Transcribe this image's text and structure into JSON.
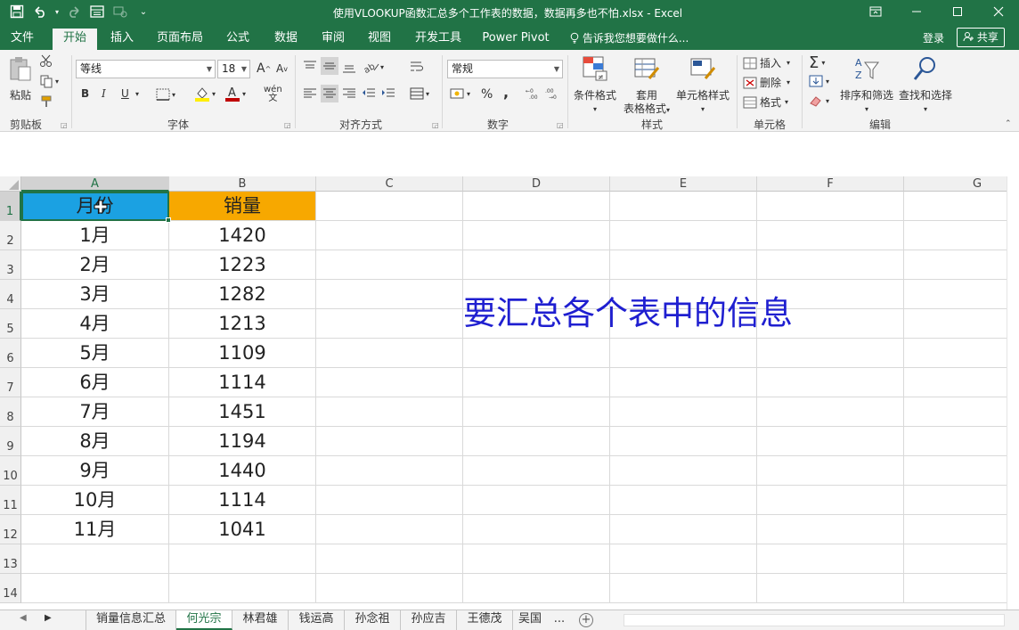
{
  "titlebar": {
    "doc_title": "使用VLOOKUP函数汇总多个工作表的数据，数据再多也不怕.xlsx - Excel",
    "qat_more": "⌄"
  },
  "tabs": [
    {
      "label": "文件"
    },
    {
      "label": "开始"
    },
    {
      "label": "插入"
    },
    {
      "label": "页面布局"
    },
    {
      "label": "公式"
    },
    {
      "label": "数据"
    },
    {
      "label": "审阅"
    },
    {
      "label": "视图"
    },
    {
      "label": "开发工具"
    },
    {
      "label": "Power Pivot"
    }
  ],
  "tellme": "告诉我您想要做什么...",
  "login": "登录",
  "share": "共享",
  "ribbon": {
    "clipboard": {
      "paste": "粘贴",
      "group": "剪贴板"
    },
    "font": {
      "name": "等线",
      "size": "18",
      "group": "字体",
      "bold": "B",
      "italic": "I",
      "underline": "U",
      "grow": "A",
      "shrink": "A",
      "wen": "wén"
    },
    "align": {
      "group": "对齐方式"
    },
    "number": {
      "format": "常规",
      "group": "数字",
      "percent": "%",
      "comma": ","
    },
    "styles": {
      "cond": "条件格式",
      "table1": "套用",
      "table2": "表格格式",
      "cell": "单元格样式",
      "group": "样式"
    },
    "cells": {
      "insert": "插入",
      "delete": "删除",
      "format": "格式",
      "group": "单元格"
    },
    "editing": {
      "sort": "排序和筛选",
      "find": "查找和选择",
      "group": "编辑"
    }
  },
  "columns": [
    "A",
    "B",
    "C",
    "D",
    "E",
    "F",
    "G"
  ],
  "rows": [
    "1",
    "2",
    "3",
    "4",
    "5",
    "6",
    "7",
    "8",
    "9",
    "10",
    "11",
    "12",
    "13",
    "14"
  ],
  "table": {
    "header": [
      "月份",
      "销量"
    ],
    "rows": [
      [
        "1月",
        "1420"
      ],
      [
        "2月",
        "1223"
      ],
      [
        "3月",
        "1282"
      ],
      [
        "4月",
        "1213"
      ],
      [
        "5月",
        "1109"
      ],
      [
        "6月",
        "1114"
      ],
      [
        "7月",
        "1451"
      ],
      [
        "8月",
        "1194"
      ],
      [
        "9月",
        "1440"
      ],
      [
        "10月",
        "1114"
      ],
      [
        "11月",
        "1041"
      ]
    ]
  },
  "note": "要汇总各个表中的信息",
  "sheets": [
    {
      "label": "销量信息汇总"
    },
    {
      "label": "何光宗"
    },
    {
      "label": "林君雄"
    },
    {
      "label": "钱运高"
    },
    {
      "label": "孙念祖"
    },
    {
      "label": "孙应吉"
    },
    {
      "label": "王德茂"
    },
    {
      "label": "吴国"
    }
  ],
  "sheet_more": "...",
  "colors": {
    "accent": "#217346",
    "header_a": "#1ba1e2",
    "header_b": "#f7a800",
    "note": "#1f1fd0"
  }
}
